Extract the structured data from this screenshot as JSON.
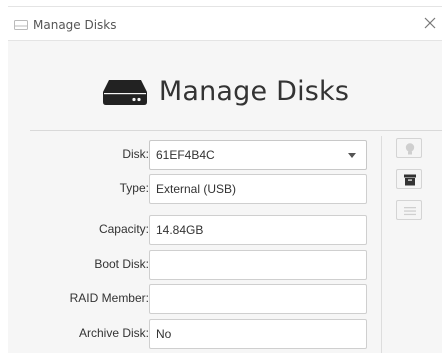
{
  "window": {
    "title": "Manage Disks",
    "icon": "hard-drive-icon",
    "close_icon": "close-icon"
  },
  "header": {
    "title": "Manage Disks",
    "icon": "hard-drive-icon"
  },
  "form": {
    "disk": {
      "label": "Disk:",
      "value": "61EF4B4C"
    },
    "type": {
      "label": "Type:",
      "value": "External (USB)"
    },
    "capacity": {
      "label": "Capacity:",
      "value": "14.84GB"
    },
    "boot_disk": {
      "label": "Boot Disk:",
      "value": ""
    },
    "raid_member": {
      "label": "RAID Member:",
      "value": ""
    },
    "archive_disk": {
      "label": "Archive Disk:",
      "value": "No"
    }
  },
  "side_buttons": [
    {
      "icon": "lightbulb-icon",
      "enabled": false
    },
    {
      "icon": "archive-box-icon",
      "enabled": true
    },
    {
      "icon": "list-icon",
      "enabled": false
    }
  ],
  "colors": {
    "window_bg": "#f6f6f6",
    "field_bg": "#ffffff",
    "text": "#333333"
  }
}
